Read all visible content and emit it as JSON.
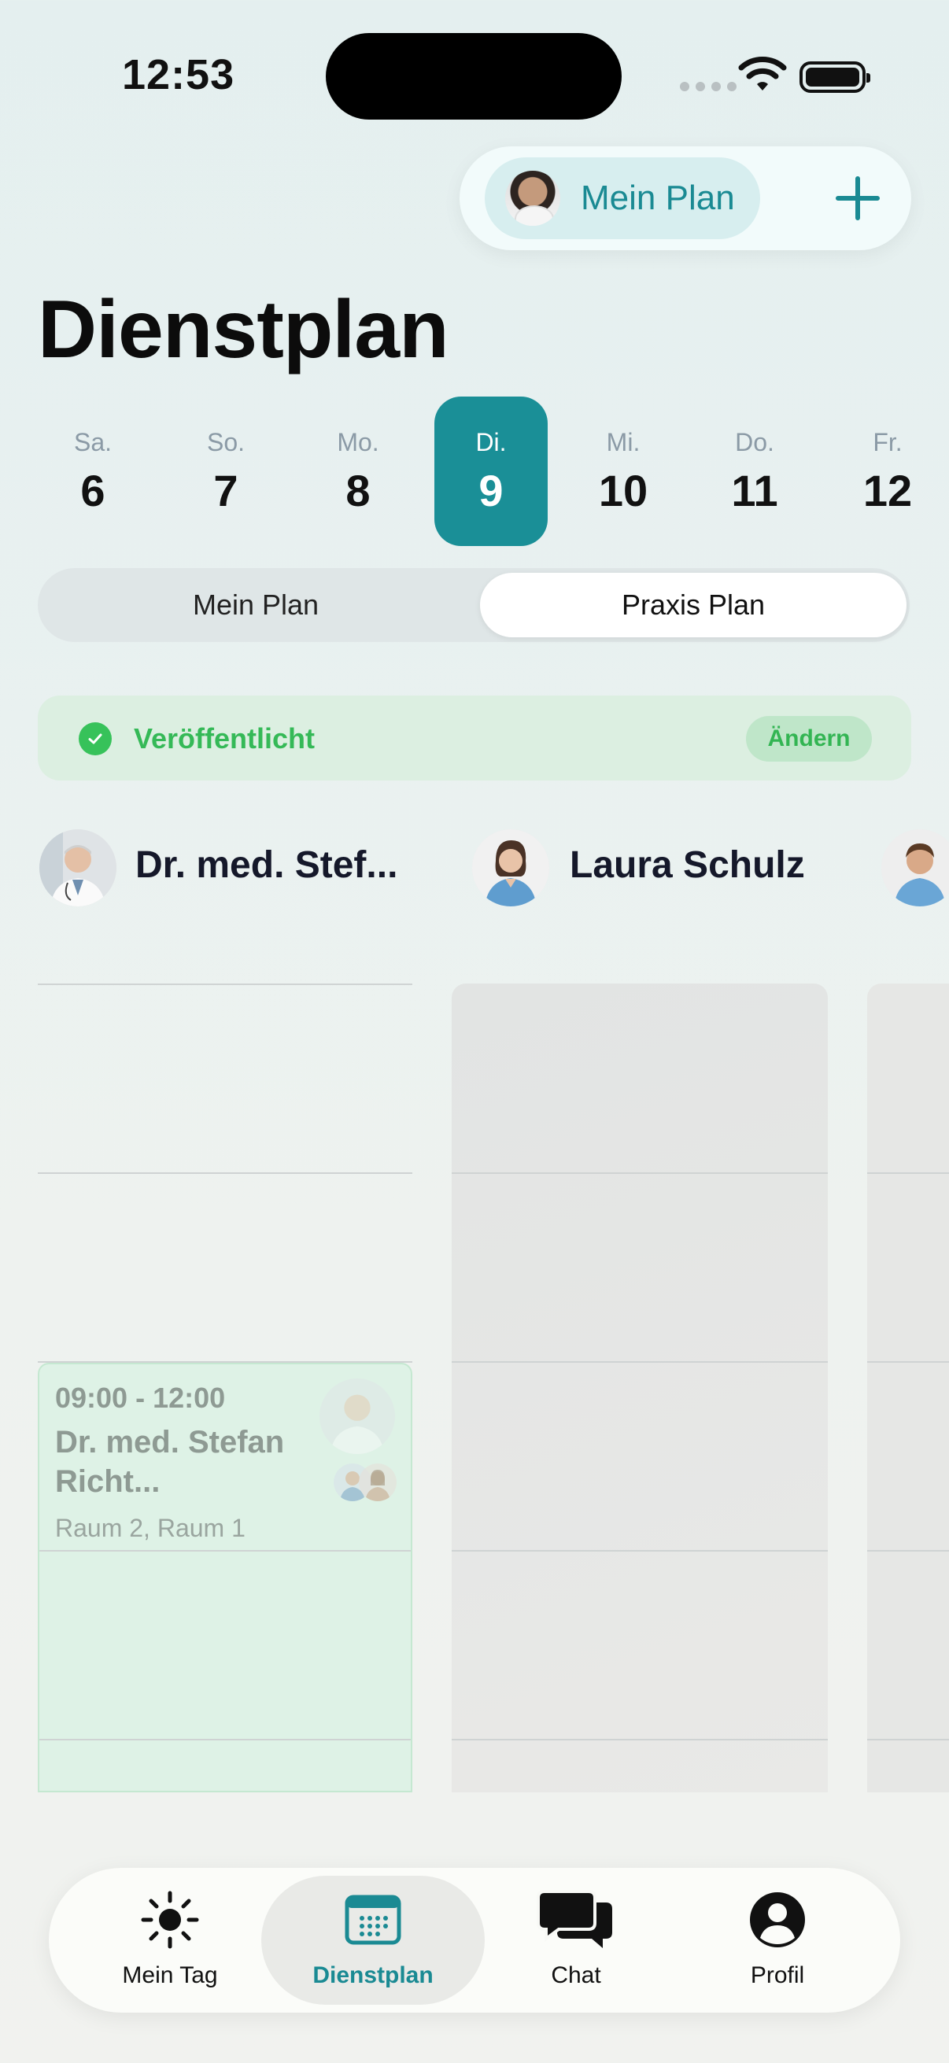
{
  "status_bar": {
    "time": "12:53"
  },
  "top_actions": {
    "my_plan_label": "Mein Plan"
  },
  "page_title": "Dienstplan",
  "days": [
    {
      "name": "Sa.",
      "date": "6",
      "selected": false
    },
    {
      "name": "So.",
      "date": "7",
      "selected": false
    },
    {
      "name": "Mo.",
      "date": "8",
      "selected": false
    },
    {
      "name": "Di.",
      "date": "9",
      "selected": true
    },
    {
      "name": "Mi.",
      "date": "10",
      "selected": false
    },
    {
      "name": "Do.",
      "date": "11",
      "selected": false
    },
    {
      "name": "Fr.",
      "date": "12",
      "selected": false
    }
  ],
  "segmented": {
    "left": "Mein Plan",
    "right": "Praxis Plan",
    "selected": "right"
  },
  "publish": {
    "status": "Veröffentlicht",
    "edit": "Ändern"
  },
  "staff": [
    {
      "name": "Dr. med. Stef..."
    },
    {
      "name": "Laura Schulz"
    }
  ],
  "event": {
    "time": "09:00 - 12:00",
    "name": "Dr. med. Stefan Richt...",
    "rooms": "Raum 2, Raum 1"
  },
  "tabs": [
    {
      "label": "Mein Tag",
      "icon": "sun-icon",
      "active": false
    },
    {
      "label": "Dienstplan",
      "icon": "calendar-icon",
      "active": true
    },
    {
      "label": "Chat",
      "icon": "chat-bubbles-icon",
      "active": false
    },
    {
      "label": "Profil",
      "icon": "person-circle-icon",
      "active": false
    }
  ],
  "colors": {
    "accent": "#1a8f97",
    "published_green": "#35b957"
  }
}
